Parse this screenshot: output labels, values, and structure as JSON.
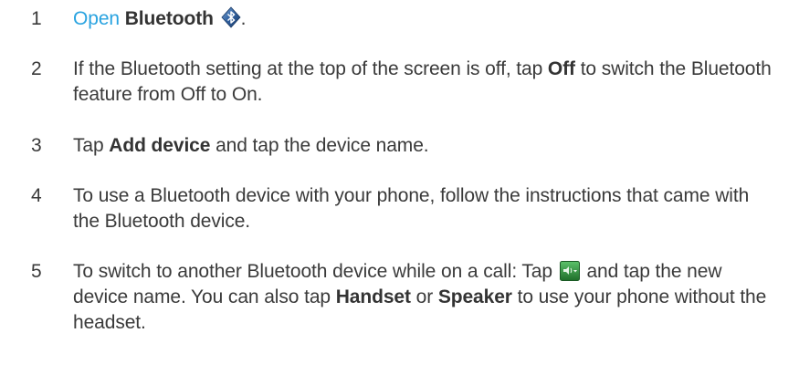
{
  "steps": [
    {
      "number": "1",
      "link": "Open",
      "bold": "Bluetooth",
      "icon": "bluetooth-icon",
      "end": "."
    },
    {
      "number": "2",
      "text_before": "If the Bluetooth setting at the top of the screen is off, tap ",
      "bold": "Off",
      "text_after": " to switch the Bluetooth feature from Off to On."
    },
    {
      "number": "3",
      "text_before": "Tap ",
      "bold": "Add device",
      "text_after": " and tap the device name."
    },
    {
      "number": "4",
      "text": "To use a Bluetooth device with your phone, follow the instructions that came with the Bluetooth device."
    },
    {
      "number": "5",
      "text_before": "To switch to another Bluetooth device while on a call: Tap ",
      "icon": "audio-route-icon",
      "text_middle": " and tap the new device name. You can also tap ",
      "bold_1": "Handset",
      "text_or": " or ",
      "bold_2": "Speaker",
      "text_after": " to use your phone without the headset."
    }
  ],
  "colors": {
    "text": "#3a3a3a",
    "link": "#29a3e0",
    "icon_green": "#2e8b3a"
  }
}
